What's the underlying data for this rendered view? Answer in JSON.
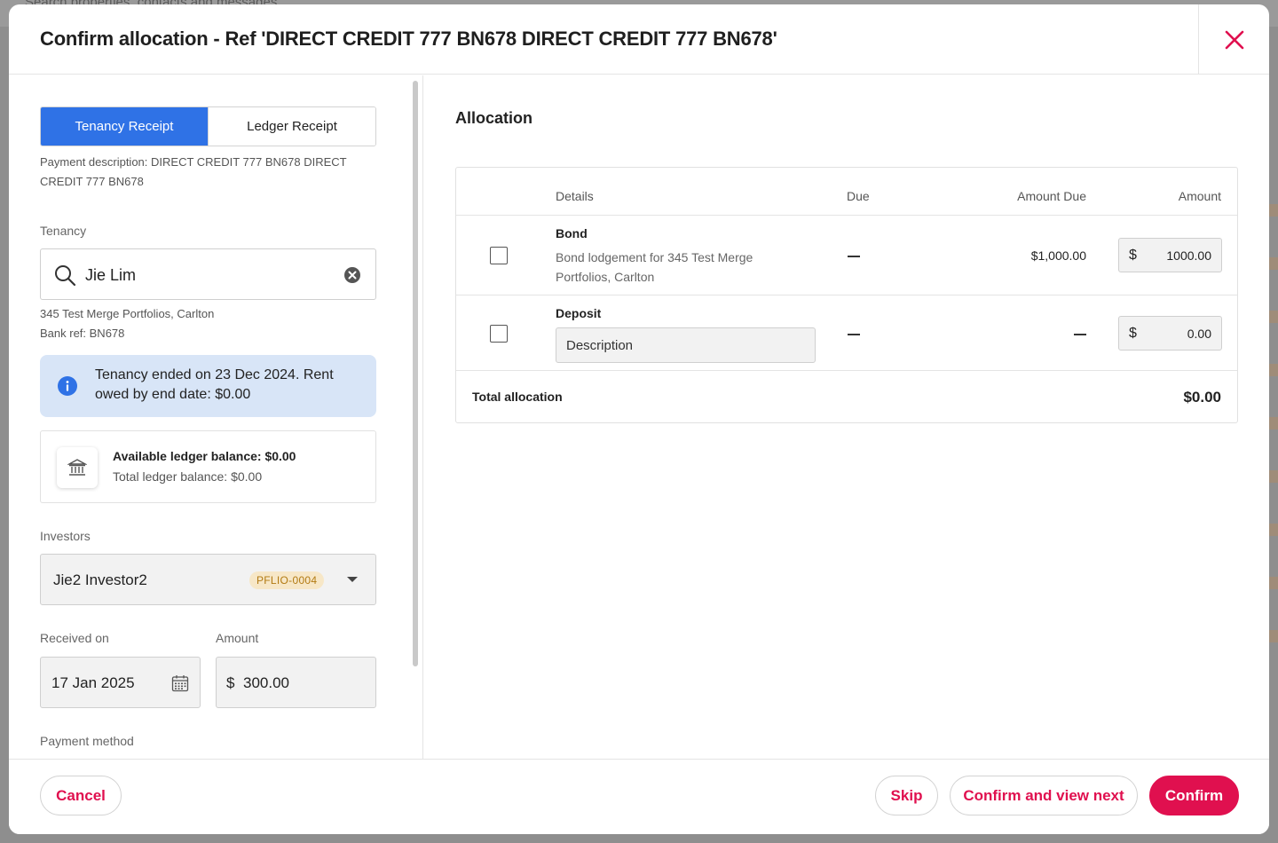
{
  "background": {
    "search_text": "Search properties, contacts and messages"
  },
  "modal": {
    "title": "Confirm allocation - Ref 'DIRECT CREDIT 777 BN678 DIRECT CREDIT 777 BN678'"
  },
  "left": {
    "tabs": [
      {
        "label": "Tenancy Receipt",
        "active": true
      },
      {
        "label": "Ledger Receipt",
        "active": false
      }
    ],
    "payment_description": "Payment description: DIRECT CREDIT 777 BN678 DIRECT CREDIT 777 BN678",
    "tenancy": {
      "label": "Tenancy",
      "value": "Jie Lim",
      "address": "345 Test Merge Portfolios, Carlton",
      "bank_ref": "Bank ref: BN678"
    },
    "info_notice": "Tenancy ended on 23 Dec 2024. Rent owed by end date: $0.00",
    "ledger": {
      "available": "Available ledger balance: $0.00",
      "total": "Total ledger balance: $0.00"
    },
    "investors": {
      "label": "Investors",
      "value": "Jie2 Investor2",
      "badge": "PFLIO-0004"
    },
    "received_on": {
      "label": "Received on",
      "value": "17 Jan 2025"
    },
    "amount": {
      "label": "Amount",
      "currency": "$",
      "value": "300.00"
    },
    "payment_method_label": "Payment method"
  },
  "right": {
    "title": "Allocation",
    "columns": {
      "details": "Details",
      "due": "Due",
      "amount_due": "Amount Due",
      "amount": "Amount"
    },
    "rows": [
      {
        "title": "Bond",
        "description": "Bond lodgement for 345 Test Merge Portfolios, Carlton",
        "amount_due": "$1,000.00",
        "currency": "$",
        "amount": "1000.00"
      },
      {
        "title": "Deposit",
        "description_placeholder": "Description",
        "currency": "$",
        "amount": "0.00"
      }
    ],
    "total_label": "Total allocation",
    "total_value": "$0.00"
  },
  "footer": {
    "cancel": "Cancel",
    "skip": "Skip",
    "confirm_next": "Confirm and view next",
    "confirm": "Confirm"
  },
  "colors": {
    "primary": "#e0104f",
    "tab_active": "#2f72e6",
    "info_bg": "#d8e5f7",
    "badge_bg": "#f7e7c7",
    "badge_text": "#b27a12"
  }
}
